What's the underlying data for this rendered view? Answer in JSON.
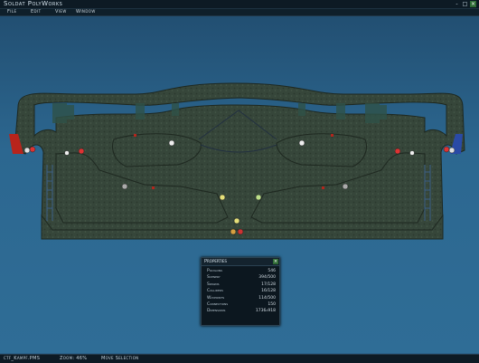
{
  "window": {
    "title": "Soldat PolyWorks",
    "buttons": [
      "-",
      "□",
      "×"
    ]
  },
  "menu": {
    "items": [
      "File",
      "Edit",
      "View",
      "Window"
    ]
  },
  "map": {
    "background_color": "#2c6790",
    "terrain_color": "#3a4a3a",
    "red_base_color": "#c0281e",
    "blue_base_color": "#2f4fb0"
  },
  "properties": {
    "title": "Properties",
    "close": "×",
    "rows": [
      {
        "label": "Polygons",
        "value": "546"
      },
      {
        "label": "Scenery",
        "value": "394/500"
      },
      {
        "label": "Spawns",
        "value": "17/128"
      },
      {
        "label": "Colliders",
        "value": "16/128"
      },
      {
        "label": "Waypoints",
        "value": "114/500"
      },
      {
        "label": "Connections",
        "value": "150"
      },
      {
        "label": "Dimensions",
        "value": "1736x918"
      }
    ]
  },
  "status": {
    "file": "ctf_Kampf.PMS",
    "zoom": "Zoom: 46%",
    "tool": "Move Selection"
  }
}
